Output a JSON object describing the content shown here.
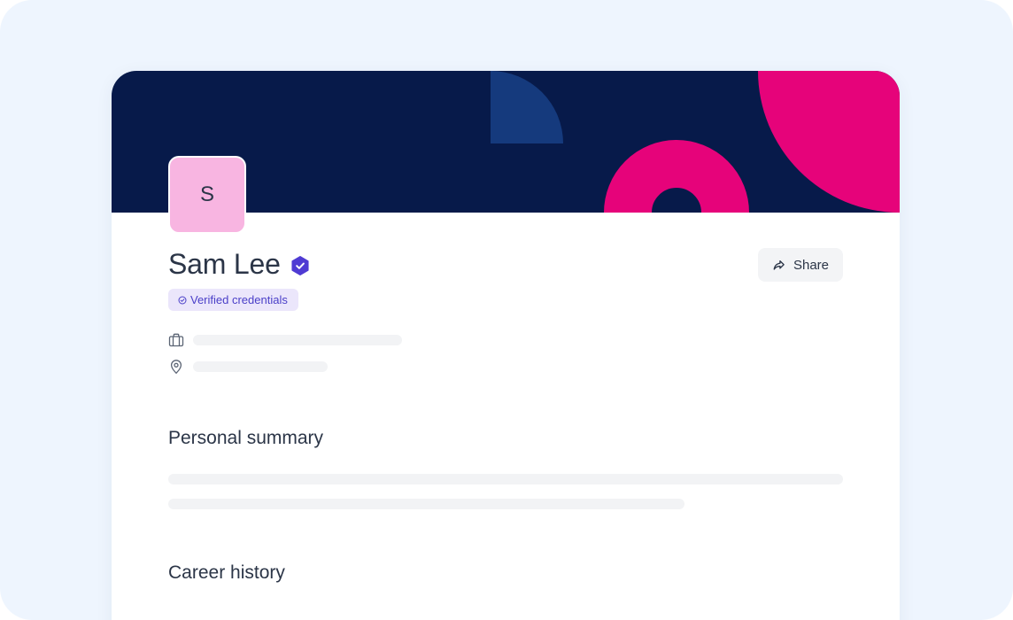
{
  "profile": {
    "avatar_initial": "S",
    "name": "Sam Lee",
    "credentials_badge": "Verified credentials"
  },
  "actions": {
    "share_label": "Share"
  },
  "sections": {
    "summary_title": "Personal summary",
    "career_title": "Career history"
  },
  "icons": {
    "verified": "verified-shield-icon",
    "badge_check": "check-circle-icon",
    "share": "share-arrow-icon",
    "work": "briefcase-icon",
    "location": "location-pin-icon"
  },
  "colors": {
    "banner": "#071a4a",
    "accent_pink": "#e6037a",
    "accent_blue": "#153a7d",
    "verified_purple": "#4f3bd3",
    "avatar_bg": "#f8b5e1"
  }
}
